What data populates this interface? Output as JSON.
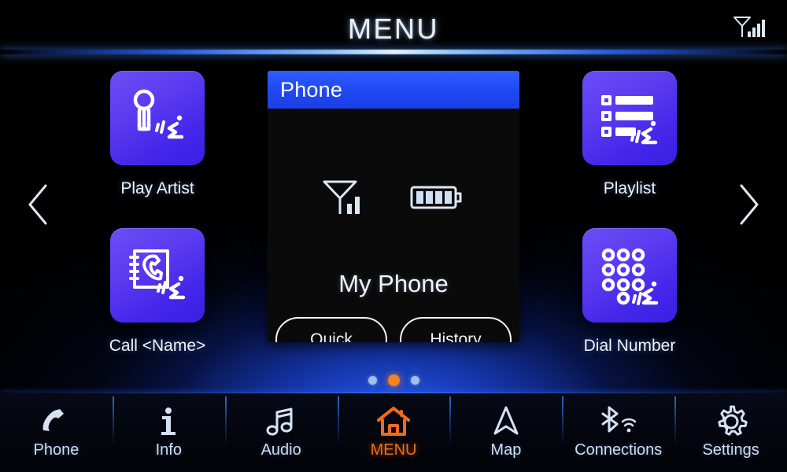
{
  "header": {
    "title": "MENU",
    "status_icon": "signal-antenna-icon",
    "signal_bars": 4
  },
  "colors": {
    "accent_orange": "#f26a1b",
    "tile_purple": "#4f30ef",
    "widget_header_blue": "#1f46f2",
    "glow_blue": "#2a60ff",
    "text_light": "#eef3fb"
  },
  "nav_arrows": {
    "previous": "chevron-left-icon",
    "next": "chevron-right-icon"
  },
  "tiles": [
    {
      "id": "play-artist",
      "label": "Play Artist",
      "icon": "microphone-voice-icon",
      "position": "pos-tl"
    },
    {
      "id": "call-name",
      "label": "Call <Name>",
      "icon": "contacts-handset-voice-icon",
      "position": "pos-bl"
    },
    {
      "id": "playlist",
      "label": "Playlist",
      "icon": "list-voice-icon",
      "position": "pos-tr"
    },
    {
      "id": "dial-number",
      "label": "Dial Number",
      "icon": "keypad-voice-icon",
      "position": "pos-br"
    }
  ],
  "widget": {
    "title": "Phone",
    "device_name": "My Phone",
    "signal_icon": "signal-antenna-icon",
    "signal_bars": 2,
    "battery_icon": "battery-full-icon",
    "battery_segments": 4,
    "buttons": [
      {
        "id": "quick",
        "label": "Quick"
      },
      {
        "id": "history",
        "label": "History"
      }
    ]
  },
  "pagination": {
    "total": 3,
    "active_index": 1
  },
  "navbar": {
    "items": [
      {
        "id": "phone",
        "label": "Phone",
        "icon": "phone-handset-icon",
        "active": false
      },
      {
        "id": "info",
        "label": "Info",
        "icon": "info-icon",
        "active": false
      },
      {
        "id": "audio",
        "label": "Audio",
        "icon": "music-note-icon",
        "active": false
      },
      {
        "id": "menu",
        "label": "MENU",
        "icon": "home-icon",
        "active": true
      },
      {
        "id": "map",
        "label": "Map",
        "icon": "navigation-arrow-icon",
        "active": false
      },
      {
        "id": "connections",
        "label": "Connections",
        "icon": "bluetooth-wifi-icon",
        "active": false
      },
      {
        "id": "settings",
        "label": "Settings",
        "icon": "gear-icon",
        "active": false
      }
    ]
  }
}
